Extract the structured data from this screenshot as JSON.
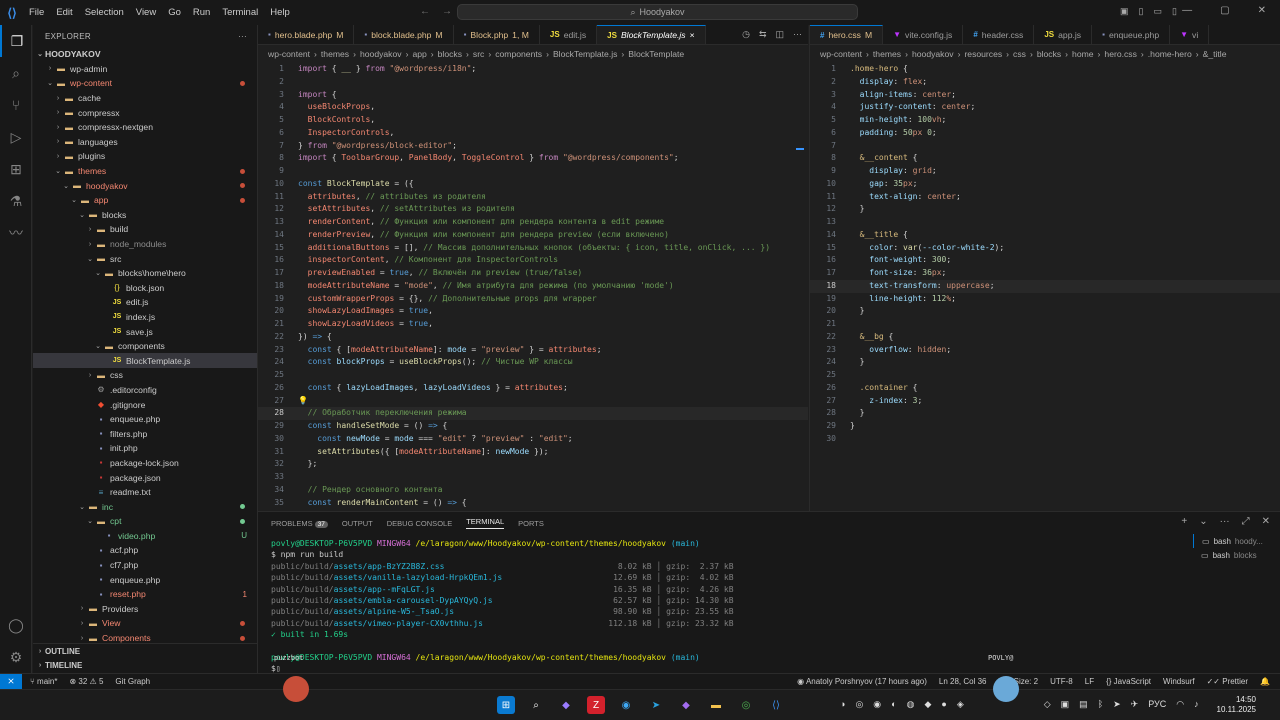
{
  "menu": [
    "File",
    "Edit",
    "Selection",
    "View",
    "Go",
    "Run",
    "Terminal",
    "Help"
  ],
  "search_text": "Hoodyakov",
  "explorer": {
    "title": "EXPLORER",
    "root": "HOODYAKOV",
    "items": [
      {
        "d": 1,
        "t": "folder",
        "label": "wp-admin",
        "open": false
      },
      {
        "d": 1,
        "t": "folder",
        "label": "wp-content",
        "open": true,
        "cls": "c-del",
        "dot": true
      },
      {
        "d": 2,
        "t": "folder",
        "label": "cache",
        "open": false
      },
      {
        "d": 2,
        "t": "folder",
        "label": "compressx",
        "open": false
      },
      {
        "d": 2,
        "t": "folder",
        "label": "compressx-nextgen",
        "open": false
      },
      {
        "d": 2,
        "t": "folder",
        "label": "languages",
        "open": false
      },
      {
        "d": 2,
        "t": "folder",
        "label": "plugins",
        "open": false
      },
      {
        "d": 2,
        "t": "folder",
        "label": "themes",
        "open": true,
        "cls": "c-del",
        "dot": true
      },
      {
        "d": 3,
        "t": "folder",
        "label": "hoodyakov",
        "open": true,
        "cls": "c-del",
        "dot": true
      },
      {
        "d": 4,
        "t": "folder",
        "label": "app",
        "open": true,
        "cls": "c-del",
        "dot": true
      },
      {
        "d": 5,
        "t": "folder",
        "label": "blocks",
        "open": true
      },
      {
        "d": 6,
        "t": "folder",
        "label": "build",
        "open": false
      },
      {
        "d": 6,
        "t": "folder",
        "label": "node_modules",
        "open": false,
        "cls": "c-grey"
      },
      {
        "d": 6,
        "t": "folder",
        "label": "src",
        "open": true
      },
      {
        "d": 7,
        "t": "folder",
        "label": "blocks\\home\\hero",
        "open": true
      },
      {
        "d": 8,
        "t": "json",
        "label": "block.json"
      },
      {
        "d": 8,
        "t": "js",
        "label": "edit.js"
      },
      {
        "d": 8,
        "t": "js",
        "label": "index.js"
      },
      {
        "d": 8,
        "t": "js",
        "label": "save.js"
      },
      {
        "d": 7,
        "t": "folder",
        "label": "components",
        "open": true
      },
      {
        "d": 8,
        "t": "js",
        "label": "BlockTemplate.js",
        "sel": true
      },
      {
        "d": 6,
        "t": "folder",
        "label": "css",
        "open": false
      },
      {
        "d": 6,
        "t": "gear",
        "label": ".editorconfig"
      },
      {
        "d": 6,
        "t": "git",
        "label": ".gitignore"
      },
      {
        "d": 6,
        "t": "php",
        "label": "enqueue.php"
      },
      {
        "d": 6,
        "t": "php",
        "label": "filters.php"
      },
      {
        "d": 6,
        "t": "php",
        "label": "init.php"
      },
      {
        "d": 6,
        "t": "npm",
        "label": "package-lock.json"
      },
      {
        "d": 6,
        "t": "npm",
        "label": "package.json"
      },
      {
        "d": 6,
        "t": "md",
        "label": "readme.txt"
      },
      {
        "d": 5,
        "t": "folder",
        "label": "inc",
        "open": true,
        "cls": "c-green",
        "gdot": true
      },
      {
        "d": 6,
        "t": "folder",
        "label": "cpt",
        "open": true,
        "cls": "c-green",
        "gdot": true
      },
      {
        "d": 7,
        "t": "php",
        "label": "video.php",
        "cls": "c-green",
        "badge": "U"
      },
      {
        "d": 6,
        "t": "php",
        "label": "acf.php"
      },
      {
        "d": 6,
        "t": "php",
        "label": "cf7.php"
      },
      {
        "d": 6,
        "t": "php",
        "label": "enqueue.php"
      },
      {
        "d": 6,
        "t": "php",
        "label": "reset.php",
        "cls": "c-del",
        "badge": "1"
      },
      {
        "d": 5,
        "t": "folder",
        "label": "Providers",
        "open": false
      },
      {
        "d": 5,
        "t": "folder",
        "label": "View",
        "open": false,
        "cls": "c-del",
        "dot": true
      },
      {
        "d": 5,
        "t": "folder",
        "label": "Components",
        "open": false,
        "cls": "c-del",
        "dot": true
      }
    ],
    "outline": "OUTLINE",
    "timeline": "TIMELINE"
  },
  "tabs1": [
    {
      "label": "hero.blade.php",
      "mod": "M",
      "icon": "php",
      "cls": "c-mod"
    },
    {
      "label": "block.blade.php",
      "mod": "M",
      "icon": "php",
      "cls": "c-mod"
    },
    {
      "label": "Block.php",
      "mod": "1, M",
      "icon": "php",
      "cls": "c-mod"
    },
    {
      "label": "edit.js",
      "mod": "",
      "icon": "js"
    },
    {
      "label": "BlockTemplate.js",
      "mod": "×",
      "icon": "js",
      "active": true
    }
  ],
  "breadcrumb1": [
    "wp-content",
    "themes",
    "hoodyakov",
    "app",
    "blocks",
    "src",
    "components",
    "BlockTemplate.js",
    "BlockTemplate"
  ],
  "tabs2": [
    {
      "label": "hero.css",
      "mod": "M",
      "icon": "css",
      "active": true,
      "cls": "c-mod"
    },
    {
      "label": "vite.config.js",
      "mod": "",
      "icon": "vite"
    },
    {
      "label": "header.css",
      "mod": "",
      "icon": "css"
    },
    {
      "label": "app.js",
      "mod": "",
      "icon": "js"
    },
    {
      "label": "enqueue.php",
      "mod": "",
      "icon": "php"
    },
    {
      "label": "vi",
      "mod": "",
      "icon": "vite"
    }
  ],
  "breadcrumb2": [
    "wp-content",
    "themes",
    "hoodyakov",
    "resources",
    "css",
    "blocks",
    "home",
    "hero.css",
    ".home-hero",
    "&_title"
  ],
  "panel": {
    "tabs": [
      "PROBLEMS",
      "OUTPUT",
      "DEBUG CONSOLE",
      "TERMINAL",
      "PORTS"
    ],
    "problems_count": "37",
    "active": "TERMINAL",
    "terminals": [
      {
        "name": "bash",
        "sub": "hoody..."
      },
      {
        "name": "bash",
        "sub": "blocks"
      }
    ]
  },
  "terminal": {
    "prompt_user": "povly@DESKTOP-P6V5PVD",
    "prompt_env": "MINGW64",
    "prompt_path": "/e/laragon/www/Hoodyakov/wp-content/themes/hoodyakov",
    "prompt_branch": "(main)",
    "cmd": "$ npm run build",
    "files": [
      {
        "dir": "public/build/",
        "name": "assets/app-BzYZ2B8Z.css",
        "size": "8.02 kB",
        "gzip": "gzip:  2.37 kB"
      },
      {
        "dir": "public/build/",
        "name": "assets/vanilla-lazyload-HrpkQEm1.js",
        "size": "12.69 kB",
        "gzip": "gzip:  4.02 kB"
      },
      {
        "dir": "public/build/",
        "name": "assets/app--mFqLGT.js",
        "size": "16.35 kB",
        "gzip": "gzip:  4.26 kB"
      },
      {
        "dir": "public/build/",
        "name": "assets/embla-carousel-DypAYQyQ.js",
        "size": "62.57 kB",
        "gzip": "gzip: 14.30 kB"
      },
      {
        "dir": "public/build/",
        "name": "assets/alpine-W5-_TsaO.js",
        "size": "98.90 kB",
        "gzip": "gzip: 23.55 kB"
      },
      {
        "dir": "public/build/",
        "name": "assets/vimeo-player-CX0vthhu.js",
        "size": "112.18 kB",
        "gzip": "gzip: 23.32 kB"
      }
    ],
    "built": "✓ built in 1.69s",
    "prompt_user2": "povly@DESKTOP-P6V5PVD",
    "prompt_cursor": "$"
  },
  "status": {
    "branch": "main*",
    "errors": "32",
    "warnings": "5",
    "git_graph": "Git Graph",
    "blame": "Anatoly Porshnyov (17 hours ago)",
    "position": "Ln 28, Col 36",
    "tab": "Tab Size: 2",
    "encoding": "UTF-8",
    "eol": "LF",
    "language": "JavaScript",
    "windsurf": "Windsurf",
    "prettier": "Prettier"
  },
  "clock": {
    "time": "14:50",
    "date": "10.11.2025"
  },
  "tray": {
    "lang": "РУС"
  },
  "overlay": {
    "left": "puzzbot",
    "right": "POVLY@"
  }
}
